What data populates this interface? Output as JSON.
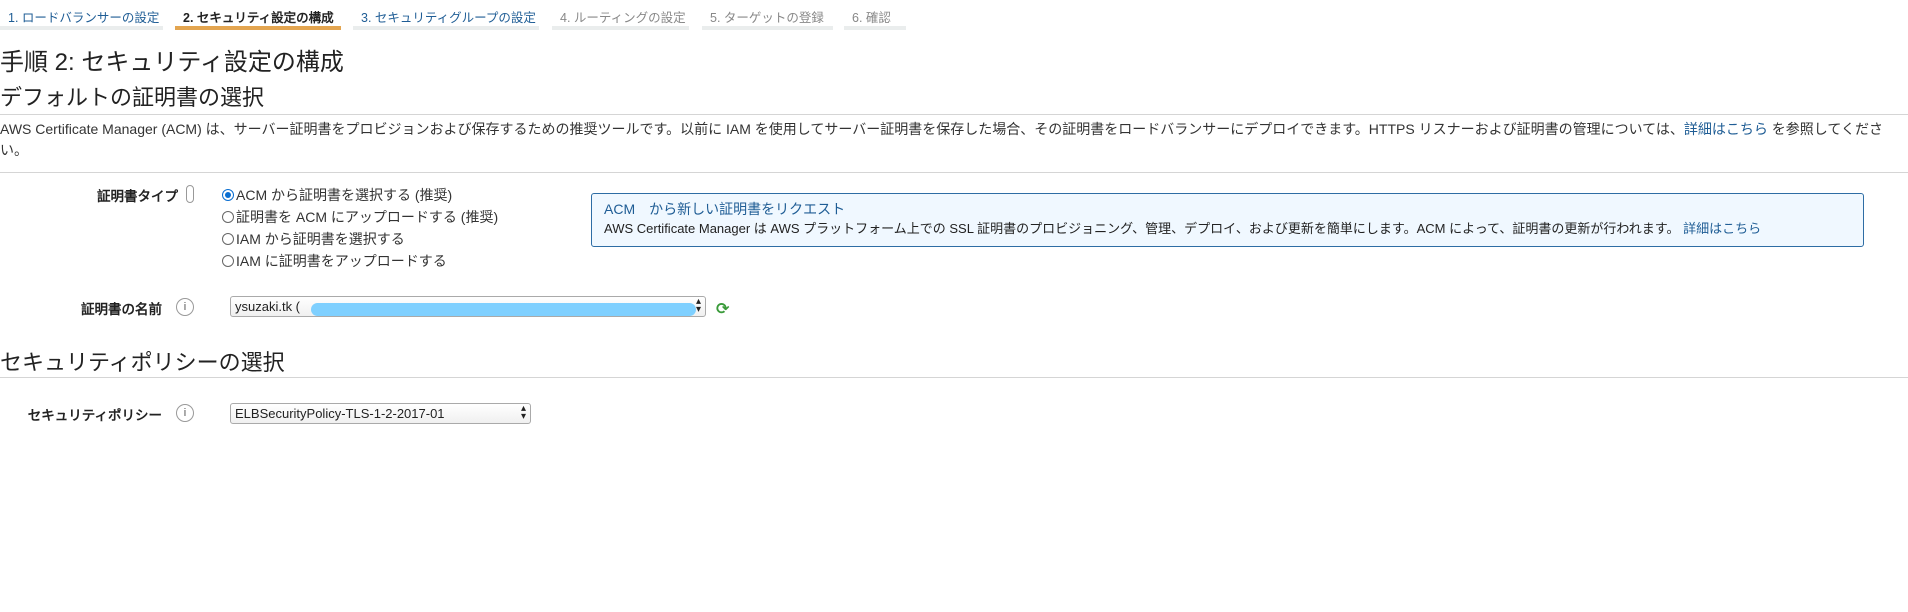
{
  "tabs": [
    {
      "label": "1. ロードバランサーの設定",
      "state": "link"
    },
    {
      "label": "2. セキュリティ設定の構成",
      "state": "active"
    },
    {
      "label": "3. セキュリティグループの設定",
      "state": "link"
    },
    {
      "label": "4. ルーティングの設定",
      "state": "disabled"
    },
    {
      "label": "5. ターゲットの登録",
      "state": "disabled"
    },
    {
      "label": "6. 確認",
      "state": "disabled"
    }
  ],
  "page_title": "手順 2: セキュリティ設定の構成",
  "cert_section": {
    "heading": "デフォルトの証明書の選択",
    "desc_before": "AWS Certificate Manager (ACM) は、サーバー証明書をプロビジョンおよび保存するための推奨ツールです。以前に IAM を使用してサーバー証明書を保存した場合、その証明書をロードバランサーにデプロイできます。HTTPS リスナーおよび証明書の管理については、",
    "desc_link": "詳細はこちら",
    "desc_after": " を参照してください。",
    "type_label": "証明書タイプ",
    "options": [
      "ACM から証明書を選択する (推奨)",
      "証明書を ACM にアップロードする (推奨)",
      "IAM から証明書を選択する",
      "IAM に証明書をアップロードする"
    ],
    "selected_option": 0,
    "info_box": {
      "title": "ACM　から新しい証明書をリクエスト",
      "text": "AWS Certificate Manager は AWS プラットフォーム上での SSL 証明書のプロビジョニング、管理、デプロイ、および更新を簡単にします。ACM によって、証明書の更新が行われます。",
      "link": "詳細はこちら"
    },
    "name_label": "証明書の名前",
    "name_value": "ysuzaki.tk (",
    "info_icon": "i"
  },
  "policy_section": {
    "heading": "セキュリティポリシーの選択",
    "label": "セキュリティポリシー",
    "value": "ELBSecurityPolicy-TLS-1-2-2017-01"
  },
  "colors": {
    "active_tab": "#e3a550",
    "link": "#1f5d95",
    "info_border": "#2e6da4",
    "redaction": "#7fd0ff"
  }
}
